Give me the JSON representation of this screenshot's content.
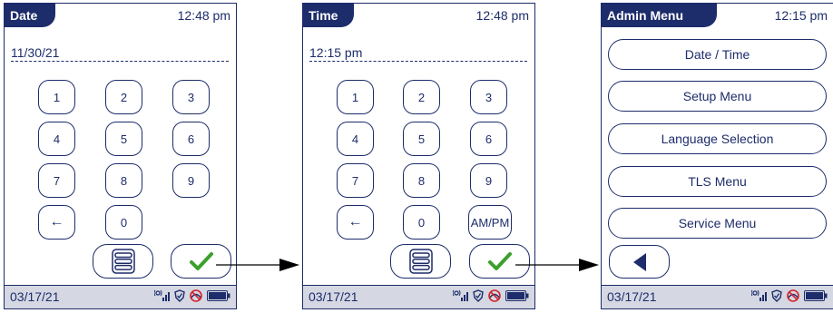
{
  "screens": [
    {
      "title": "Date",
      "time": "12:48 pm",
      "entry": "11/30/21",
      "keys": [
        "1",
        "2",
        "3",
        "4",
        "5",
        "6",
        "7",
        "8",
        "9",
        "←",
        "0"
      ],
      "footer_date": "03/17/21"
    },
    {
      "title": "Time",
      "time": "12:48 pm",
      "entry": "12:15 pm",
      "keys": [
        "1",
        "2",
        "3",
        "4",
        "5",
        "6",
        "7",
        "8",
        "9",
        "←",
        "0",
        "AM/PM"
      ],
      "footer_date": "03/17/21"
    },
    {
      "title": "Admin Menu",
      "time": "12:15 pm",
      "menu": [
        "Date / Time",
        "Setup Menu",
        "Language Selection",
        "TLS Menu",
        "Service Menu"
      ],
      "footer_date": "03/17/21"
    }
  ],
  "icons": {
    "status": [
      "signal-icon",
      "shield-icon",
      "no-wireless-icon",
      "battery-icon"
    ],
    "confirm": "checkmark-icon",
    "menu": "menu-list-icon",
    "back": "back-triangle-icon"
  },
  "colors": {
    "primary": "#1d2c6a",
    "footer_bg": "#d5d8e3",
    "check": "#3aa12b"
  }
}
